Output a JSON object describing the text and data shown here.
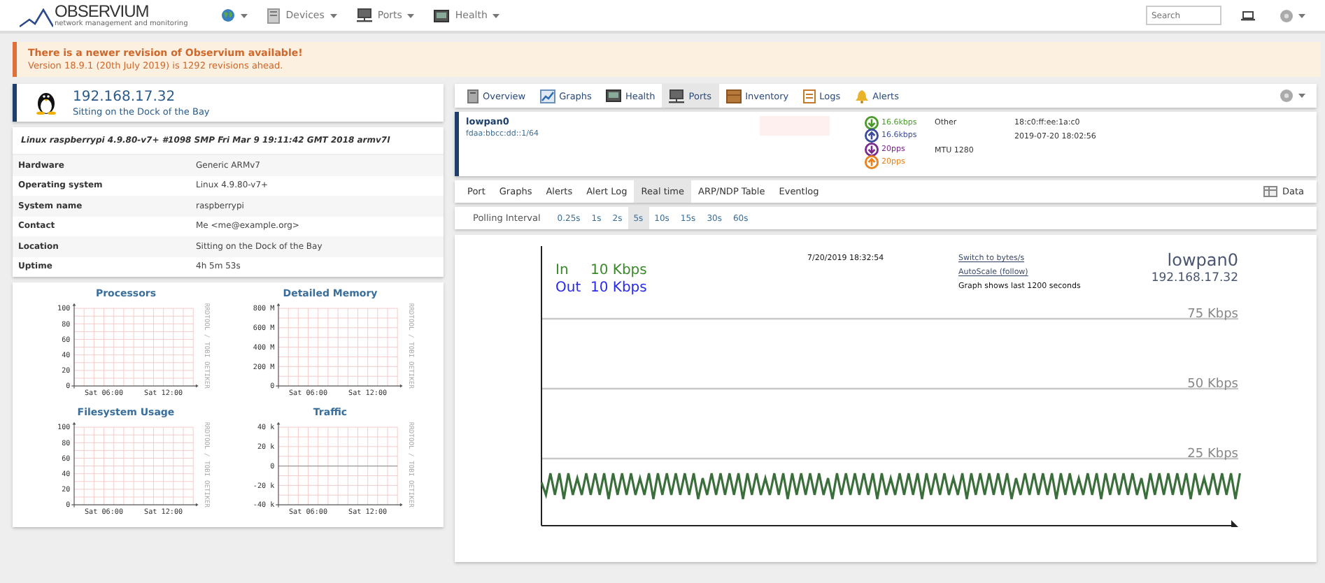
{
  "navbar": {
    "logo": "OBSERVIUM",
    "tagline": "network management and monitoring",
    "menus": [
      {
        "kind": "globe"
      },
      {
        "kind": "devices",
        "label": "Devices"
      },
      {
        "kind": "ports",
        "label": "Ports"
      },
      {
        "kind": "health",
        "label": "Health"
      }
    ],
    "search": {
      "placeholder": "Search"
    }
  },
  "alert": {
    "title": "There is a newer revision of Observium available!",
    "message": "Version 18.9.1 (20th July 2019) is 1292 revisions ahead."
  },
  "device": {
    "ip": "192.168.17.32",
    "location": "Sitting on the Dock of the Bay"
  },
  "info": {
    "os_line": "Linux raspberrypi 4.9.80-v7+ #1098 SMP Fri Mar 9 19:11:42 GMT 2018 armv7l",
    "rows": [
      {
        "label": "Hardware",
        "value": "Generic ARMv7"
      },
      {
        "label": "Operating system",
        "value": "Linux 4.9.80-v7+"
      },
      {
        "label": "System name",
        "value": "raspberrypi"
      },
      {
        "label": "Contact",
        "value": "Me <me@example.org>"
      },
      {
        "label": "Location",
        "value": "Sitting on the Dock of the Bay"
      },
      {
        "label": "Uptime",
        "value": "4h 5m 53s"
      }
    ]
  },
  "graphs": [
    {
      "title": "Processors",
      "kind": "plain",
      "yticks": [
        "100",
        "80",
        "60",
        "40",
        "20",
        "0"
      ],
      "xticks": [
        "Sat 06:00",
        "Sat 12:00"
      ],
      "side_label": "RRDTOOL / TOBI OETIKER"
    },
    {
      "title": "Detailed Memory",
      "kind": "plain",
      "yticks": [
        "800 M",
        "600 M",
        "400 M",
        "200 M",
        "0"
      ],
      "xticks": [
        "Sat 06:00",
        "Sat 12:00"
      ],
      "side_label": "RRDTOOL / TOBI OETIKER"
    },
    {
      "title": "Filesystem Usage",
      "kind": "plain",
      "yticks": [
        "100",
        "80",
        "60",
        "40",
        "20",
        "0"
      ],
      "xticks": [
        "Sat 06:00",
        "Sat 12:00"
      ],
      "side_label": "RRDTOOL / TOBI OETIKER"
    },
    {
      "title": "Traffic",
      "kind": "bipolar",
      "yticks": [
        "40 k",
        "20 k",
        "0",
        "-20 k",
        "-40 k"
      ],
      "xticks": [
        "Sat 06:00",
        "Sat 12:00"
      ],
      "side_label": "RRDTOOL / TOBI OETIKER"
    }
  ],
  "tabs": [
    {
      "label": "Overview",
      "kind": "server",
      "selected": false
    },
    {
      "label": "Graphs",
      "kind": "chart",
      "selected": false
    },
    {
      "label": "Health",
      "kind": "monitor",
      "selected": false
    },
    {
      "label": "Ports",
      "kind": "network",
      "selected": true
    },
    {
      "label": "Inventory",
      "kind": "box",
      "selected": false
    },
    {
      "label": "Logs",
      "kind": "log",
      "selected": false
    },
    {
      "label": "Alerts",
      "kind": "bell",
      "selected": false
    }
  ],
  "port": {
    "name": "lowpan0",
    "address": "fdaa:bbcc:dd::1/64",
    "rates": [
      {
        "text": "16.6kbps",
        "color": "#4a9a2a",
        "kind": "in"
      },
      {
        "text": "16.6kbps",
        "color": "#3d4c9a",
        "kind": "out"
      },
      {
        "text": "20pps",
        "color": "#7a2a8a",
        "kind": "in"
      },
      {
        "text": "20pps",
        "color": "#e8821c",
        "kind": "out"
      }
    ],
    "type": "Other",
    "mtu": "MTU 1280",
    "mac": "18:c0:ff:ee:1a:c0",
    "changed": "2019-07-20 18:02:56"
  },
  "subtabs": [
    {
      "label": "Port",
      "selected": false
    },
    {
      "label": "Graphs",
      "selected": false
    },
    {
      "label": "Alerts",
      "selected": false
    },
    {
      "label": "Alert Log",
      "selected": false
    },
    {
      "label": "Real time",
      "selected": true
    },
    {
      "label": "ARP/NDP Table",
      "selected": false
    },
    {
      "label": "Eventlog",
      "selected": false
    }
  ],
  "data_button": "Data",
  "polling": {
    "label": "Polling Interval",
    "options": [
      {
        "label": "0.25s",
        "selected": false
      },
      {
        "label": "1s",
        "selected": false
      },
      {
        "label": "2s",
        "selected": false
      },
      {
        "label": "5s",
        "selected": true
      },
      {
        "label": "10s",
        "selected": false
      },
      {
        "label": "15s",
        "selected": false
      },
      {
        "label": "30s",
        "selected": false
      },
      {
        "label": "60s",
        "selected": false
      }
    ]
  },
  "realtime": {
    "legend": [
      {
        "name": "In",
        "value": "10 Kbps",
        "color": "#3a8a2a"
      },
      {
        "name": "Out",
        "value": "10 Kbps",
        "color": "#2a2aee"
      }
    ],
    "timestamp": "7/20/2019 18:32:54",
    "links": [
      "Switch to bytes/s",
      "AutoScale (follow)"
    ],
    "note": "Graph shows last 1200 seconds",
    "title": "lowpan0",
    "subtitle": "192.168.17.32",
    "gridlines": [
      "75 Kbps",
      "50 Kbps",
      "25 Kbps"
    ]
  }
}
